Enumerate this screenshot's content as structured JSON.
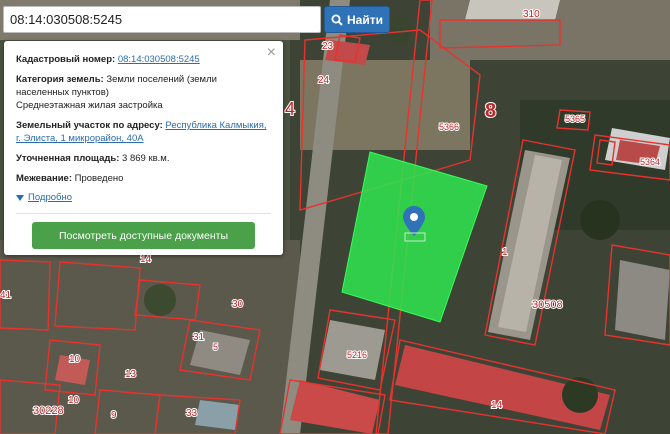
{
  "search": {
    "value": "08:14:030508:5245",
    "button_label": "Найти"
  },
  "map": {
    "parcel_labels": [
      "310",
      "23",
      "24",
      "8",
      "5366",
      "5365",
      "5364",
      "4",
      "1",
      "30508",
      "14",
      "30",
      "31",
      "5216",
      "10",
      "9",
      "33",
      "13",
      "14",
      "41",
      "10",
      "30228",
      "5"
    ],
    "selected_parcel_color": "#2ee64f",
    "boundary_color": "#e8322e"
  },
  "card": {
    "cadastral_label": "Кадастровый номер:",
    "cadastral_value": "08:14:030508:5245",
    "category_label": "Категория земель:",
    "category_value": "Земли поселений (земли населенных пунктов)",
    "category_use": "Среднеэтажная жилая застройка",
    "address_label": "Земельный участок по адресу:",
    "address_value": "Республика Калмыкия, г. Элиста, 1 микрорайон, 40А",
    "area_label": "Уточненная площадь:",
    "area_value": "3 869 кв.м.",
    "survey_label": "Межевание:",
    "survey_value": "Проведено",
    "more_label": "Подробно",
    "docs_button": "Посмотреть доступные документы",
    "close": "×"
  }
}
